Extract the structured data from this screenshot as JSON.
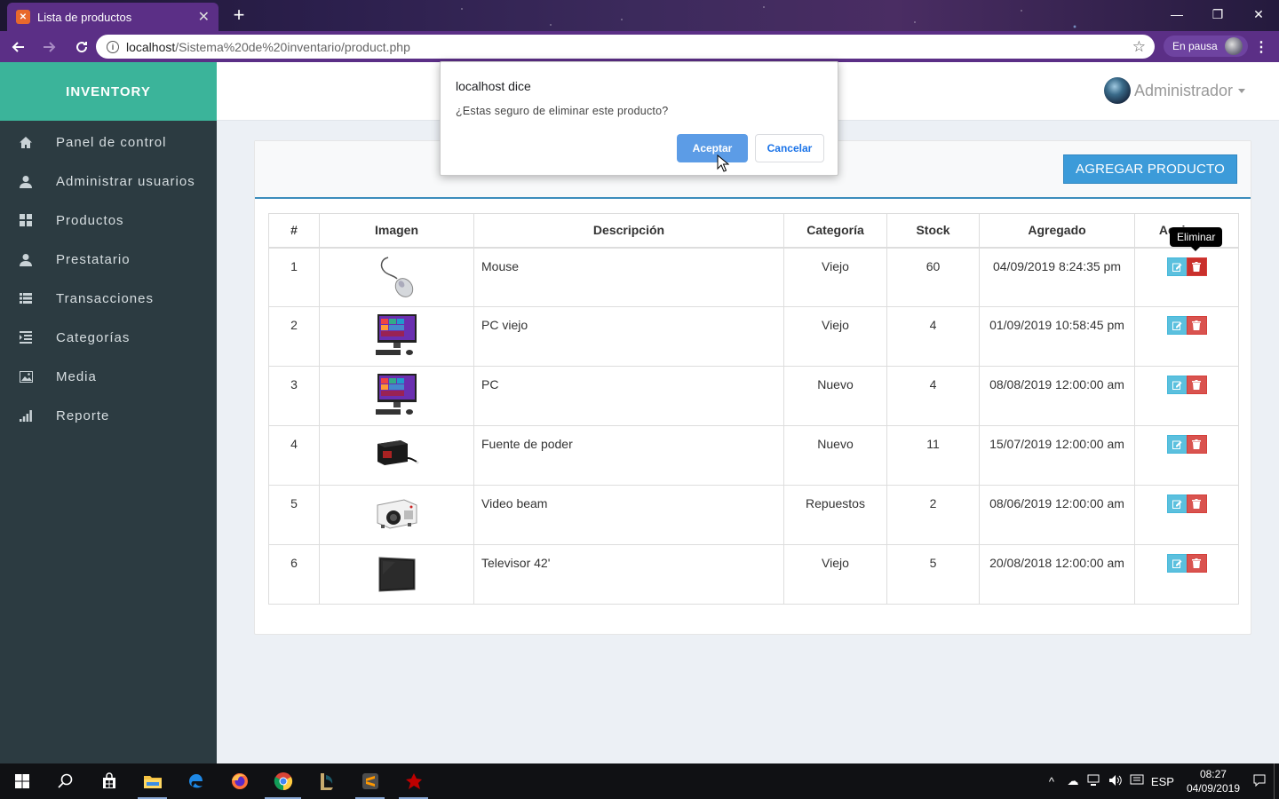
{
  "browser": {
    "tab_title": "Lista de productos",
    "url_host": "localhost",
    "url_path": "/Sistema%20de%20inventario/product.php",
    "profile_status": "En pausa"
  },
  "sidebar": {
    "brand": "INVENTORY",
    "items": [
      {
        "label": "Panel de control",
        "icon": "home-icon"
      },
      {
        "label": "Administrar usuarios",
        "icon": "user-icon"
      },
      {
        "label": "Productos",
        "icon": "grid-icon"
      },
      {
        "label": "Prestatario",
        "icon": "user-icon"
      },
      {
        "label": "Transacciones",
        "icon": "list-icon"
      },
      {
        "label": "Categorías",
        "icon": "indent-icon"
      },
      {
        "label": "Media",
        "icon": "picture-icon"
      },
      {
        "label": "Reporte",
        "icon": "signal-icon"
      }
    ]
  },
  "header": {
    "user_name": "Administrador"
  },
  "panel": {
    "add_button": "AGREGAR PRODUCTO"
  },
  "table": {
    "columns": [
      "#",
      "Imagen",
      "Descripción",
      "Categoría",
      "Stock",
      "Agregado",
      "Acciones"
    ],
    "rows": [
      {
        "num": "1",
        "image": "mouse",
        "desc": "Mouse",
        "cat": "Viejo",
        "stock": "60",
        "added": "04/09/2019 8:24:35 pm"
      },
      {
        "num": "2",
        "image": "pc",
        "desc": "PC viejo",
        "cat": "Viejo",
        "stock": "4",
        "added": "01/09/2019 10:58:45 pm"
      },
      {
        "num": "3",
        "image": "pc",
        "desc": "PC",
        "cat": "Nuevo",
        "stock": "4",
        "added": "08/08/2019 12:00:00 am"
      },
      {
        "num": "4",
        "image": "power-supply",
        "desc": "Fuente de poder",
        "cat": "Nuevo",
        "stock": "11",
        "added": "15/07/2019 12:00:00 am"
      },
      {
        "num": "5",
        "image": "projector",
        "desc": "Video beam",
        "cat": "Repuestos",
        "stock": "2",
        "added": "08/06/2019 12:00:00 am"
      },
      {
        "num": "6",
        "image": "tv",
        "desc": "Televisor 42'",
        "cat": "Viejo",
        "stock": "5",
        "added": "20/08/2018 12:00:00 am"
      }
    ]
  },
  "tooltip": "Eliminar",
  "dialog": {
    "title": "localhost dice",
    "message": "¿Estas seguro de eliminar este producto?",
    "ok": "Aceptar",
    "cancel": "Cancelar"
  },
  "taskbar": {
    "language": "ESP",
    "time": "08:27",
    "date": "04/09/2019"
  },
  "colors": {
    "brand": "#3bb49a",
    "sidebar": "#2c3b41",
    "primary": "#3c9bd9",
    "edit": "#5bc0de",
    "delete": "#d9534f",
    "browser_accent": "#5b2f86"
  }
}
